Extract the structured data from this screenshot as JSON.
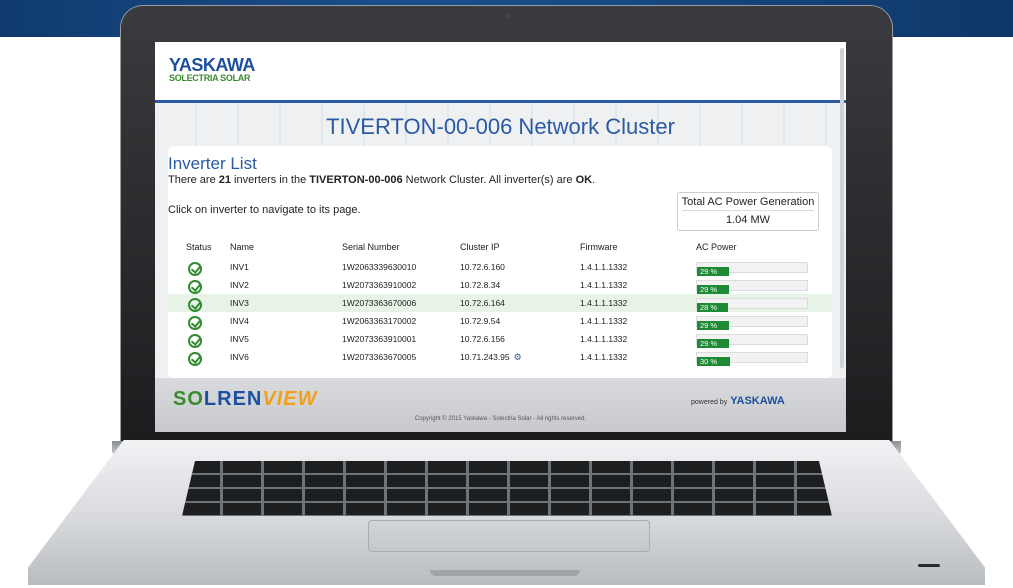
{
  "header": {
    "logo": "YASKAWA",
    "logo_sub": "SOLECTRIA SOLAR"
  },
  "page_title": "TIVERTON-00-006 Network Cluster",
  "inverter_list": {
    "heading": "Inverter List",
    "summary": "There are 21 inverters in the TIVERTON-00-006 Network Cluster. All inverter(s) are OK.",
    "hint": "Click on inverter to navigate to its page.",
    "total_label": "Total AC Power Generation",
    "total_value": "1.04 MW",
    "columns": [
      "Status",
      "Name",
      "Serial Number",
      "Cluster IP",
      "Firmware",
      "AC Power"
    ],
    "rows": [
      {
        "name": "INV1",
        "serial": "1W2063339630010",
        "ip": "10.72.6.160",
        "fw": "1.4.1.1.1332",
        "ac": "29 %",
        "ac_pct": 29
      },
      {
        "name": "INV2",
        "serial": "1W2073363910002",
        "ip": "10.72.8.34",
        "fw": "1.4.1.1.1332",
        "ac": "29 %",
        "ac_pct": 29
      },
      {
        "name": "INV3",
        "serial": "1W2073363670006",
        "ip": "10.72.6.164",
        "fw": "1.4.1.1.1332",
        "ac": "28 %",
        "ac_pct": 28
      },
      {
        "name": "INV4",
        "serial": "1W2063363170002",
        "ip": "10.72.9.54",
        "fw": "1.4.1.1.1332",
        "ac": "29 %",
        "ac_pct": 29
      },
      {
        "name": "INV5",
        "serial": "1W2073363910001",
        "ip": "10.72.6.156",
        "fw": "1.4.1.1.1332",
        "ac": "29 %",
        "ac_pct": 29
      },
      {
        "name": "INV6",
        "serial": "1W2073363670005",
        "ip": "10.71.243.95",
        "fw": "1.4.1.1.1332",
        "ac": "30 %",
        "ac_pct": 30
      }
    ]
  },
  "footer": {
    "brand_so": "S",
    "brand_lren": "LREN",
    "brand_view": "VIEW",
    "brand_o": "O",
    "copyright": "Copyright © 2015 Yaskawa - Solectria Solar - All rights reserved.",
    "powered_by": "powered by",
    "powered_brand": "YASKAWA"
  },
  "colors": {
    "accent": "#2b5aa4",
    "ok_green": "#1d8a35",
    "brand_green": "#3b8a2f",
    "brand_orange": "#f2a018"
  }
}
